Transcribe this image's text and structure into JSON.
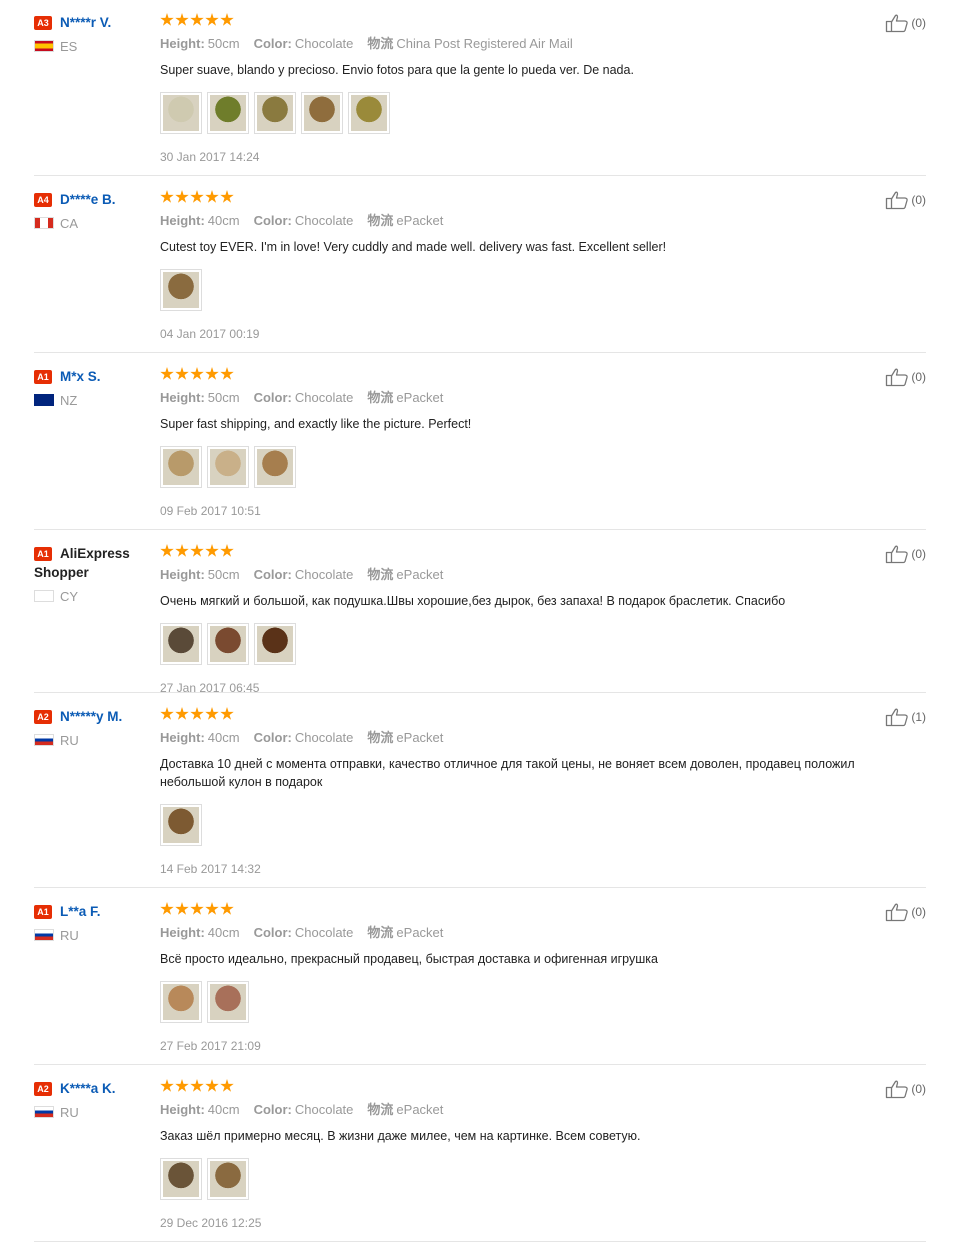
{
  "labels": {
    "height": "Height:",
    "color": "Color:",
    "logistics": "物流"
  },
  "colors": {
    "username": "#0b5bb5",
    "star": "#ff9a00",
    "badge": "#e62e04"
  },
  "reviews": [
    {
      "badge": "A3",
      "user": "N****r V.",
      "country": "ES",
      "flag": "spain-flag",
      "height": "50cm",
      "color": "Chocolate",
      "shipping": "China Post Registered Air Mail",
      "comment": "Super suave, blando y precioso. Envio fotos para que la gente lo pueda ver. De nada.",
      "photos": [
        "#cfcab0",
        "#6f7d2b",
        "#8a7a3f",
        "#8f6d3d",
        "#9a8a3a"
      ],
      "date": "30 Jan 2017 14:24",
      "likes": "(0)"
    },
    {
      "badge": "A4",
      "user": "D****e B.",
      "country": "CA",
      "flag": "canada-flag",
      "height": "40cm",
      "color": "Chocolate",
      "shipping": "ePacket",
      "comment": "Cutest toy EVER. I'm in love! Very cuddly and made well. delivery was fast. Excellent seller!",
      "photos": [
        "#8a6b3f"
      ],
      "date": "04 Jan 2017 00:19",
      "likes": "(0)"
    },
    {
      "badge": "A1",
      "user": "M*x S.",
      "country": "NZ",
      "flag": "new-zealand-flag",
      "height": "50cm",
      "color": "Chocolate",
      "shipping": "ePacket",
      "comment": "Super fast shipping, and exactly like the picture. Perfect!",
      "photos": [
        "#b89a6a",
        "#c9b089",
        "#a67e4e"
      ],
      "date": "09 Feb 2017 10:51",
      "likes": "(0)"
    },
    {
      "badge": "A1",
      "user": "AliExpress Shopper",
      "country": "CY",
      "flag": "cyprus-flag",
      "height": "50cm",
      "color": "Chocolate",
      "shipping": "ePacket",
      "comment": "Очень мягкий и большой, как подушка.Швы хорошие,без дырок, без запаха! В подарок браслетик. Спасибо",
      "photos": [
        "#5a4a38",
        "#7a4a30",
        "#5a3218"
      ],
      "date": "27 Jan 2017 06:45",
      "likes": "(0)"
    },
    {
      "badge": "A2",
      "user": "N*****y M.",
      "country": "RU",
      "flag": "russia-flag",
      "height": "40cm",
      "color": "Chocolate",
      "shipping": "ePacket",
      "comment": "Доставка 10 дней с момента отправки, качество отличное для такой цены, не воняет всем доволен, продавец положил небольшой кулон в подарок",
      "photos": [
        "#7d5a32"
      ],
      "date": "14 Feb 2017 14:32",
      "likes": "(1)"
    },
    {
      "badge": "A1",
      "user": "L**a F.",
      "country": "RU",
      "flag": "russia-flag",
      "height": "40cm",
      "color": "Chocolate",
      "shipping": "ePacket",
      "comment": "Всё просто идеально, прекрасный продавец, быстрая доставка и офигенная игрушка",
      "photos": [
        "#b8895a",
        "#a8705a"
      ],
      "date": "27 Feb 2017 21:09",
      "likes": "(0)"
    },
    {
      "badge": "A2",
      "user": "K****a K.",
      "country": "RU",
      "flag": "russia-flag",
      "height": "40cm",
      "color": "Chocolate",
      "shipping": "ePacket",
      "comment": "Заказ шёл примерно месяц. В жизни даже милее, чем на картинке. Всем советую.",
      "photos": [
        "#6a5438",
        "#8a6a40"
      ],
      "date": "29 Dec 2016 12:25",
      "likes": "(0)"
    }
  ]
}
